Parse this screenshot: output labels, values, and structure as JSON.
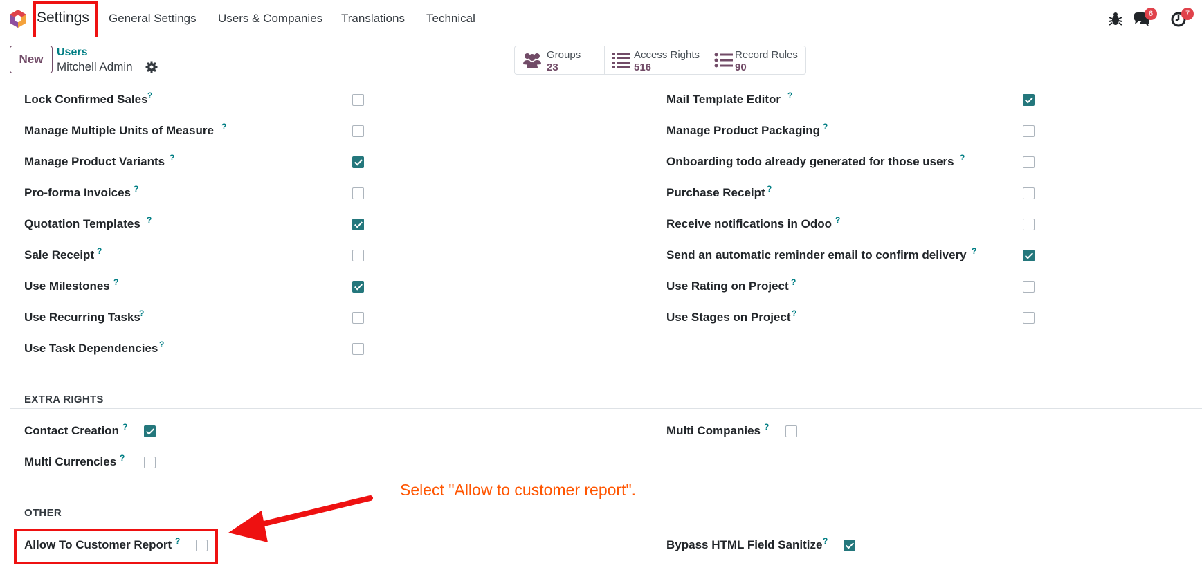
{
  "nav": {
    "app_name": "Settings",
    "menu": [
      "General Settings",
      "Users & Companies",
      "Translations",
      "Technical"
    ],
    "messages_badge": "6",
    "activity_badge": "7"
  },
  "control": {
    "new_label": "New",
    "breadcrumb_parent": "Users",
    "breadcrumb_current": "Mitchell Admin",
    "smart_buttons": [
      {
        "label": "Groups",
        "count": "23"
      },
      {
        "label": "Access Rights",
        "count": "516"
      },
      {
        "label": "Record Rules",
        "count": "90"
      }
    ]
  },
  "technical_left": [
    {
      "label": "Lock Confirmed Sales",
      "checked": false
    },
    {
      "label": "Manage Multiple Units of Measure",
      "checked": false
    },
    {
      "label": "Manage Product Variants",
      "checked": true
    },
    {
      "label": "Pro-forma Invoices",
      "checked": false
    },
    {
      "label": "Quotation Templates",
      "checked": true
    },
    {
      "label": "Sale Receipt",
      "checked": false
    },
    {
      "label": "Use Milestones",
      "checked": true
    },
    {
      "label": "Use Recurring Tasks",
      "checked": false
    },
    {
      "label": "Use Task Dependencies",
      "checked": false
    }
  ],
  "technical_right": [
    {
      "label": "Mail Template Editor",
      "checked": true
    },
    {
      "label": "Manage Product Packaging",
      "checked": false
    },
    {
      "label": "Onboarding todo already generated for those users",
      "checked": false
    },
    {
      "label": "Purchase Receipt",
      "checked": false
    },
    {
      "label": "Receive notifications in Odoo",
      "checked": false
    },
    {
      "label": "Send an automatic reminder email to confirm delivery",
      "checked": true
    },
    {
      "label": "Use Rating on Project",
      "checked": false
    },
    {
      "label": "Use Stages on Project",
      "checked": false
    }
  ],
  "extra_rights": {
    "title": "EXTRA RIGHTS",
    "left": [
      {
        "label": "Contact Creation",
        "checked": true
      },
      {
        "label": "Multi Currencies",
        "checked": false
      }
    ],
    "right": [
      {
        "label": "Multi Companies",
        "checked": false
      }
    ]
  },
  "other": {
    "title": "OTHER",
    "left": [
      {
        "label": "Allow To Customer Report",
        "checked": false
      }
    ],
    "right": [
      {
        "label": "Bypass HTML Field Sanitize",
        "checked": true
      }
    ]
  },
  "help_mark": "?",
  "annotation": "Select \"Allow to customer report\".",
  "colors": {
    "brand": "#714b67",
    "teal": "#017e84",
    "checkbox_on": "#24777c",
    "highlight": "#ee1111",
    "annotation": "#ff5500"
  }
}
